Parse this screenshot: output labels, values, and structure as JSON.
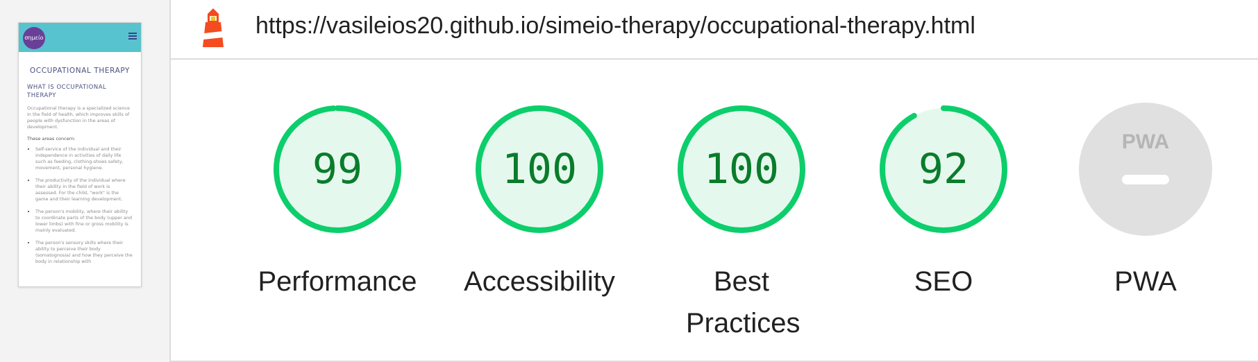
{
  "url": "https://vasileios20.github.io/simeio-therapy/occupational-therapy.html",
  "colors": {
    "pass_green": "#0cce6b",
    "pass_fill": "#e5f8ee",
    "pass_text": "#0a7c2b",
    "pwa_gray": "#e0e0e0"
  },
  "categories": [
    {
      "key": "performance",
      "score": "99",
      "label": "Performance"
    },
    {
      "key": "accessibility",
      "score": "100",
      "label": "Accessibility"
    },
    {
      "key": "best-practices",
      "score": "100",
      "label": "Best Practices"
    },
    {
      "key": "seo",
      "score": "92",
      "label": "SEO"
    },
    {
      "key": "pwa",
      "score": "",
      "label": "PWA",
      "badge": "PWA"
    }
  ],
  "preview": {
    "logo": "σημείο",
    "title": "OCCUPATIONAL THERAPY",
    "heading": "WHAT IS OCCUPATIONAL THERAPY",
    "intro": "Occupational therapy is a specialized science in the field of health, which improves skills of people with dysfunction in the areas of development.",
    "areas_label": "These areas concern:",
    "items": [
      "Self-service of the individual and their independence in activities of daily life such as feeding, clothing-shoes safety, movement, personal hygiene.",
      "The productivity of the individual where their ability in the field of work is assessed. For the child, \"work\" is the game and their learning development.",
      "The person's mobility, where their ability to coordinate parts of the body (upper and lower limbs) with fine or gross mobility is mainly evaluated.",
      "The person's sensory skills where their ability to perceive their body (somatognosia) and how they perceive the body in relationship with"
    ]
  }
}
